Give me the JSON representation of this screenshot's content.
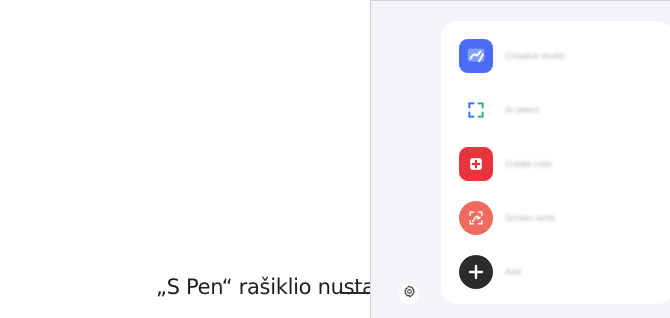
{
  "callout": {
    "text": "„S Pen“ rašiklio nustatymai"
  },
  "panel": {
    "items": [
      {
        "label": "Creative studio",
        "icon": "creative-studio-icon",
        "color": "#4a6cf7"
      },
      {
        "label": "AI select",
        "icon": "ai-select-icon",
        "color": "#ffffff"
      },
      {
        "label": "Create note",
        "icon": "create-note-icon",
        "color": "#e8343c"
      },
      {
        "label": "Screen write",
        "icon": "screen-write-icon",
        "color": "#ef6b5e"
      },
      {
        "label": "Add",
        "icon": "add-icon",
        "color": "#2b2b2b"
      }
    ]
  },
  "settings": {
    "icon": "gear-icon"
  }
}
